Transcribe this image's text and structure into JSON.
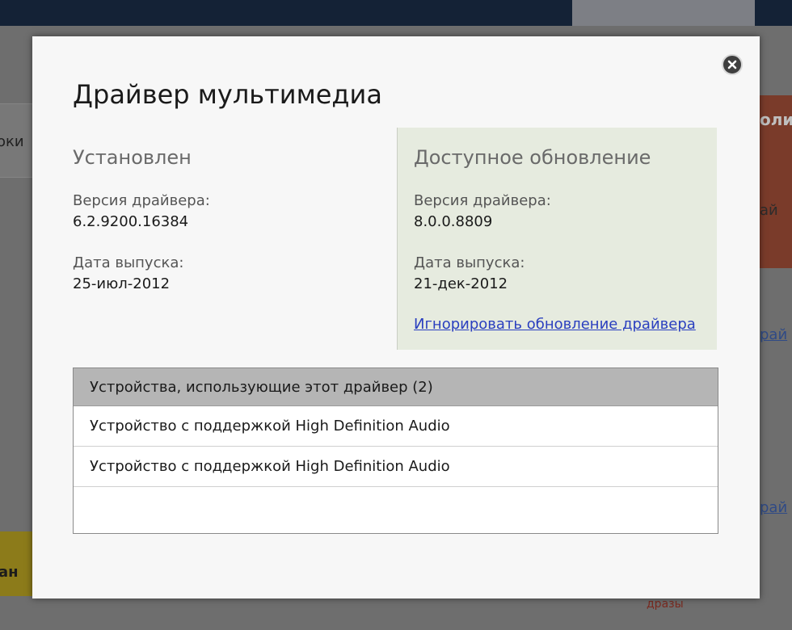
{
  "background": {
    "left_label": "оки",
    "left_yellow_label": "ан",
    "right_red_label": "оли",
    "right_strip_label": "ай",
    "right_link_1": "рай",
    "right_link_2": "рай",
    "bottom_strip_label": "дразы"
  },
  "dialog": {
    "title": "Драйвер мультимедиа",
    "close_icon": "close-icon",
    "installed": {
      "heading": "Установлен",
      "version_label": "Версия драйвера:",
      "version": "6.2.9200.16384",
      "date_label": "Дата выпуска:",
      "date": "25-июл-2012"
    },
    "update": {
      "heading": "Доступное обновление",
      "version_label": "Версия драйвера:",
      "version": "8.0.0.8809",
      "date_label": "Дата выпуска:",
      "date": "21-дек-2012",
      "ignore_link": "Игнорировать обновление драйвера"
    },
    "devices": {
      "header": "Устройства, использующие этот драйвер (2)",
      "items": [
        "Устройство с поддержкой High Definition Audio",
        "Устройство с поддержкой High Definition Audio"
      ]
    }
  },
  "colors": {
    "update_panel_bg": "#e6ebdf",
    "link": "#2a3fbf",
    "devices_header_bg": "#b5b5b5"
  }
}
